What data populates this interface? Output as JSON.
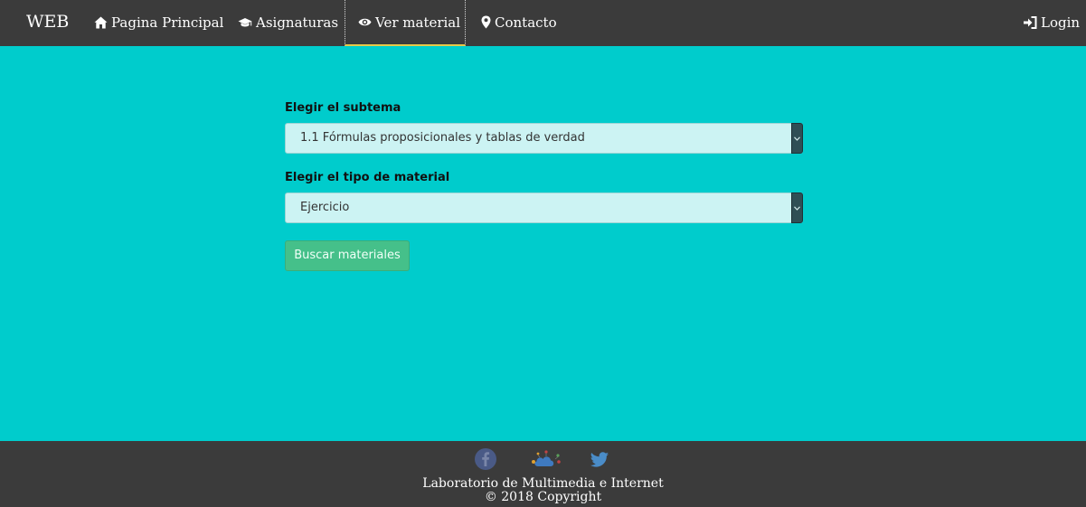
{
  "navbar": {
    "brand": "WEB",
    "items": [
      {
        "label": "Pagina Principal",
        "icon": "home-icon"
      },
      {
        "label": "Asignaturas",
        "icon": "graduation-cap-icon"
      },
      {
        "label": "Ver material",
        "icon": "eye-icon",
        "active": true
      },
      {
        "label": "Contacto",
        "icon": "map-marker-icon"
      }
    ],
    "login": {
      "label": "Login",
      "icon": "login-icon"
    },
    "active_underline_color": "#e6c84a"
  },
  "form": {
    "subtopic": {
      "label": "Elegir el subtema",
      "selected": "1.1 Fórmulas proposicionales y tablas de verdad"
    },
    "material_type": {
      "label": "Elegir el tipo de material",
      "selected": "Ejercicio"
    },
    "search_button": "Buscar materiales"
  },
  "footer": {
    "social": [
      "facebook-icon",
      "cloud-icon",
      "twitter-icon"
    ],
    "line1": "Laboratorio de Multimedia e Internet",
    "line2": "© 2018 Copyright"
  },
  "colors": {
    "background": "#00cccc",
    "bar": "#3b3b3b",
    "button": "#45c08a",
    "select_bg": "#ccf3f3"
  }
}
